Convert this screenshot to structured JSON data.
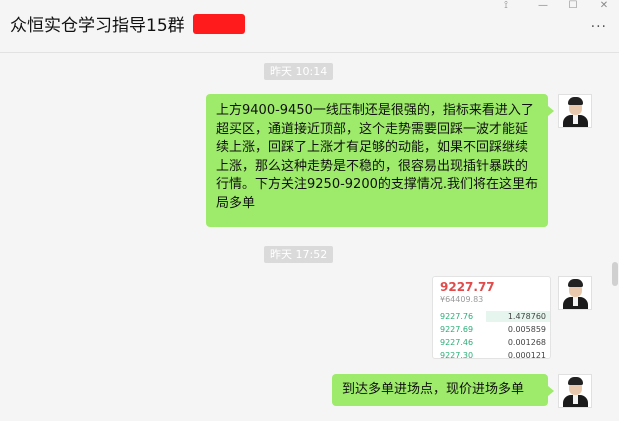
{
  "header": {
    "title": "众恒实仓学习指导15群",
    "window_controls": {
      "pin": "⟟",
      "minimize": "—",
      "maximize": "☐",
      "close": "✕"
    },
    "more_label": "···"
  },
  "messages": [
    {
      "timestamp": "昨天 10:14",
      "text": "上方9400-9450一线压制还是很强的，指标来看进入了超买区，通道接近顶部，这个走势需要回踩一波才能延续上涨，回踩了上涨才有足够的动能，如果不回踩继续上涨，那么这种走势是不稳的，很容易出现插针暴跌的行情。下方关注9250-9200的支撑情况.我们将在这里布局多单"
    },
    {
      "timestamp": "昨天 17:52",
      "image_card": {
        "price": "9227.77",
        "cny": "¥64409.83",
        "rows": [
          {
            "price": "9227.76",
            "qty": "1.478760",
            "depth": 0.55
          },
          {
            "price": "9227.69",
            "qty": "0.005859",
            "depth": 0.0
          },
          {
            "price": "9227.46",
            "qty": "0.001268",
            "depth": 0.0
          },
          {
            "price": "9227.30",
            "qty": "0.000121",
            "depth": 0.0
          }
        ]
      },
      "text": "到达多单进场点，现价进场多单"
    }
  ],
  "colors": {
    "bubble": "#9eea6a",
    "background": "#f5f5f5",
    "redaction": "#ff1b1b",
    "price_up": "#e04b4b",
    "bid": "#2bae76"
  }
}
